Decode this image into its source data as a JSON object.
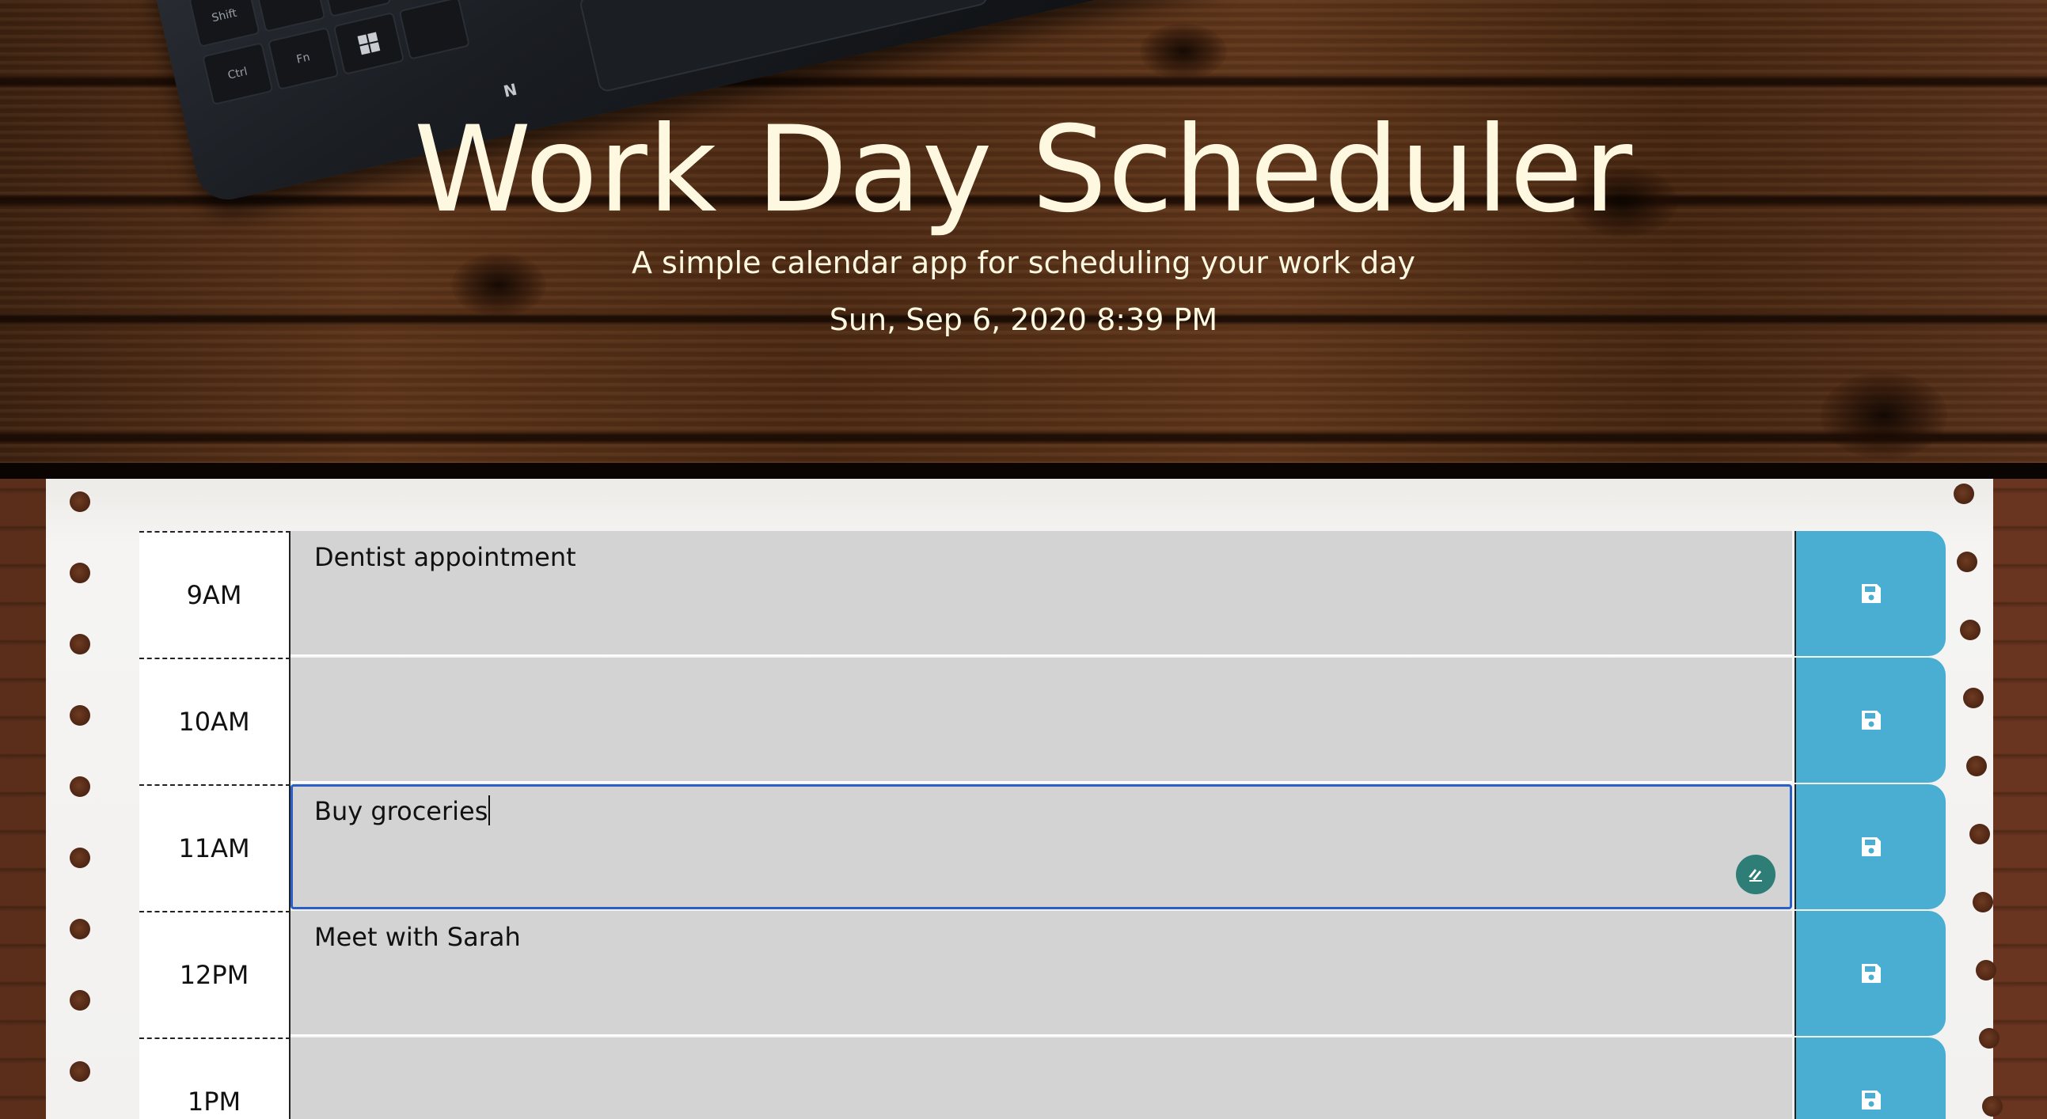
{
  "header": {
    "title": "Work Day Scheduler",
    "subtitle": "A simple calendar app for scheduling your work day",
    "current_datetime": "Sun, Sep 6, 2020 8:39 PM"
  },
  "laptop_keys": [
    "Shift",
    "Ctrl",
    "Fn"
  ],
  "time_blocks": [
    {
      "hour": "9AM",
      "text": "Dentist appointment",
      "save_icon": "floppy-disk-icon"
    },
    {
      "hour": "10AM",
      "text": "",
      "save_icon": "floppy-disk-icon"
    },
    {
      "hour": "11AM",
      "text": "Buy groceries",
      "save_icon": "floppy-disk-icon",
      "focused": true
    },
    {
      "hour": "12PM",
      "text": "Meet with Sarah",
      "save_icon": "floppy-disk-icon"
    },
    {
      "hour": "1PM",
      "text": "",
      "save_icon": "floppy-disk-icon"
    }
  ],
  "colors": {
    "past_block": "#d3d3d3",
    "save_button": "#4aadd2",
    "title_text": "#fff8e1",
    "focus_outline": "#2b5fc8"
  }
}
